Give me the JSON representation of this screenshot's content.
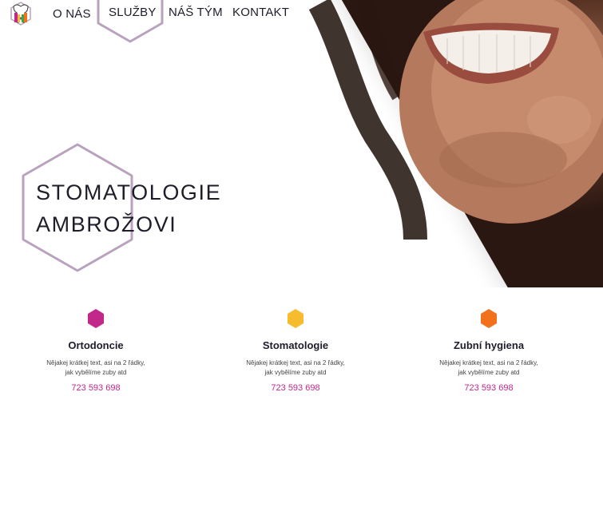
{
  "nav": {
    "items": [
      {
        "label": "O NÁS"
      },
      {
        "label": "SLUŽBY"
      },
      {
        "label": "NÁŠ TÝM"
      },
      {
        "label": "KONTAKT"
      }
    ],
    "active_index": 1
  },
  "hero": {
    "title_line1": "STOMATOLOGIE",
    "title_line2": "AMBROŽOVI"
  },
  "services": [
    {
      "icon": "hexagon-icon",
      "color": "#c2278a",
      "title": "Ortodoncie",
      "desc_line1": "Nějakej krátkej text, asi na 2 řádky,",
      "desc_line2": "jak vybělíme zuby atd",
      "phone": "723 593 698"
    },
    {
      "icon": "hexagon-icon",
      "color": "#f7bc2e",
      "title": "Stomatologie",
      "desc_line1": "Nějakej krátkej text, asi na 2 řádky,",
      "desc_line2": "jak vybělíme zuby atd",
      "phone": "723 593 698"
    },
    {
      "icon": "hexagon-icon",
      "color": "#f2711c",
      "title": "Zubní hygiena",
      "desc_line1": "Nějakej krátkej text, asi na 2 řádky,",
      "desc_line2": "jak vybělíme zuby atd",
      "phone": "723 593 698"
    }
  ],
  "colors": {
    "accent_outline": "#b9a2bd",
    "text_dark": "#1d1d2b",
    "phone": "#c2278a"
  }
}
